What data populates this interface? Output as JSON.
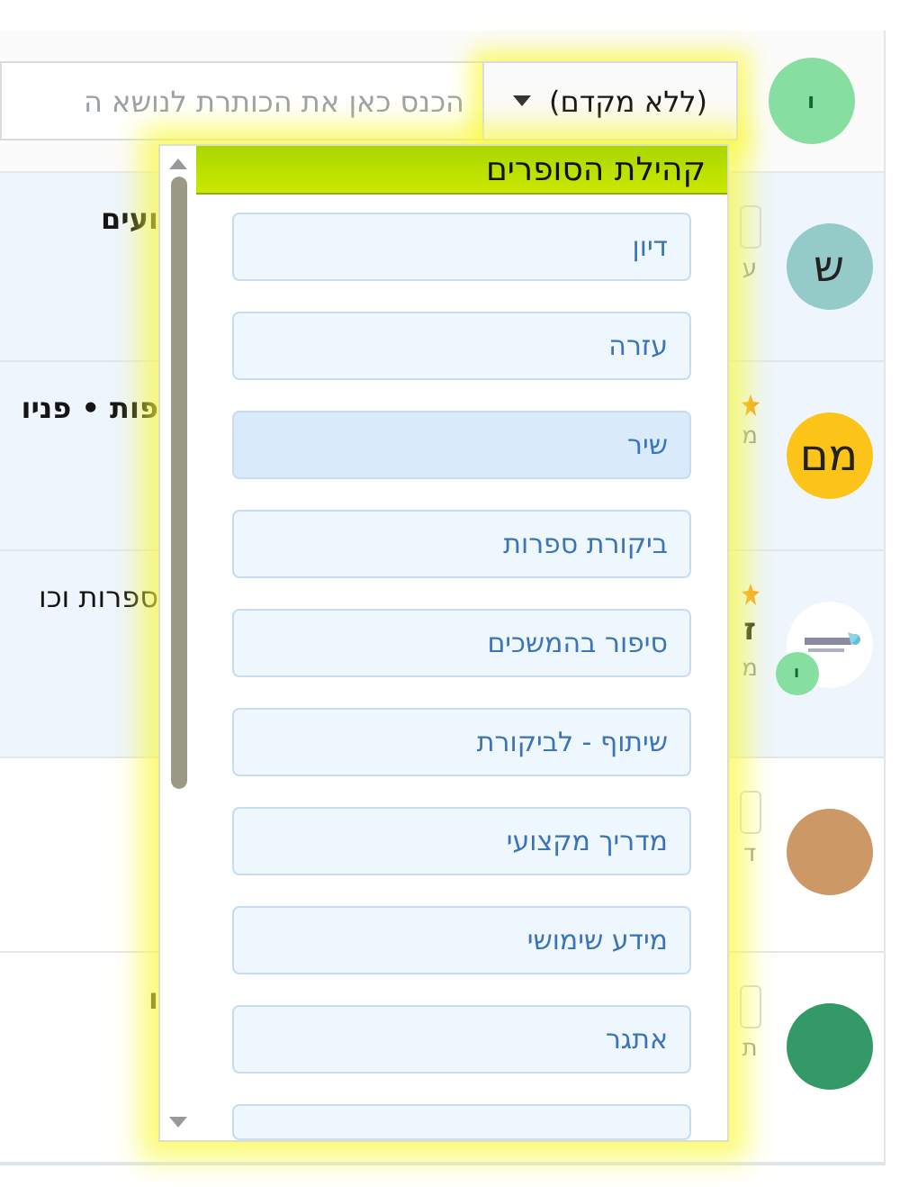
{
  "new_topic": {
    "avatar": {
      "letter": "ו",
      "color": "#86dfa0"
    },
    "prefix_button": {
      "label": "(ללא מקדם)"
    },
    "title_field": {
      "placeholder": "הכנס כאן את הכותרת לנושא ה"
    }
  },
  "topics": [
    {
      "title": "ועים",
      "bold": true,
      "avatar": {
        "kind": "letter",
        "letter": "ש",
        "color": "#94cbc9"
      },
      "highlighted": true,
      "meta": [
        {
          "kind": "badge"
        },
        {
          "kind": "text",
          "text": "ע"
        }
      ]
    },
    {
      "title": "פות • פניו",
      "bold": true,
      "avatar": {
        "kind": "letter",
        "letter": "מם",
        "color": "#fcc419"
      },
      "highlighted": true,
      "meta": [
        {
          "kind": "star"
        },
        {
          "kind": "text",
          "text": "מ"
        }
      ]
    },
    {
      "title": "ספרות וכו",
      "bold": false,
      "avatar": {
        "kind": "picture",
        "badge": {
          "letter": "ו",
          "color": "#86dfa0"
        }
      },
      "highlighted": true,
      "meta": [
        {
          "kind": "star"
        },
        {
          "kind": "strong",
          "text": "ז"
        },
        {
          "kind": "text",
          "text": "מ"
        }
      ]
    },
    {
      "avatar": {
        "kind": "plain",
        "color": "#cc9966"
      },
      "highlighted": false,
      "meta": [
        {
          "kind": "badge"
        },
        {
          "kind": "text",
          "text": "ד"
        }
      ]
    },
    {
      "title": "ו",
      "bold": true,
      "avatar": {
        "kind": "plain",
        "color": "#339966"
      },
      "highlighted": false,
      "meta": [
        {
          "kind": "badge"
        },
        {
          "kind": "text",
          "text": "ת"
        }
      ]
    }
  ],
  "prefix_menu": {
    "group": "קהילת הסופרים",
    "options": [
      {
        "label": "דיון",
        "selected": false
      },
      {
        "label": "עזרה",
        "selected": false
      },
      {
        "label": "שיר",
        "selected": true
      },
      {
        "label": "ביקורת ספרות",
        "selected": false
      },
      {
        "label": "סיפור בהמשכים",
        "selected": false
      },
      {
        "label": "שיתוף - לביקורת",
        "selected": false
      },
      {
        "label": "מדריך מקצועי",
        "selected": false
      },
      {
        "label": "מידע שימושי",
        "selected": false
      },
      {
        "label": "אתגר",
        "selected": false
      }
    ]
  }
}
